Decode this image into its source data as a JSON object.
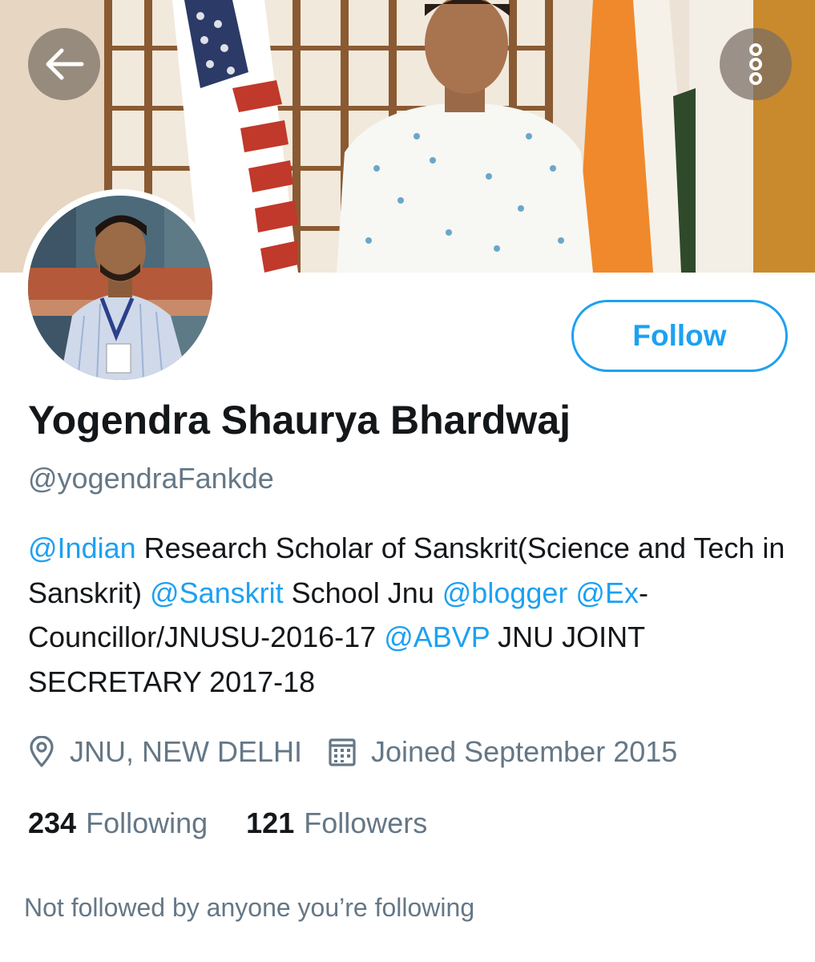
{
  "banner": {
    "back_icon": "arrow-left-icon",
    "more_icon": "more-vertical-icon"
  },
  "profile": {
    "display_name": "Yogendra Shaurya Bhardwaj",
    "handle": "@yogendraFankde",
    "follow_label": "Follow",
    "bio_segments": [
      {
        "text": "@Indian",
        "type": "mention"
      },
      {
        "text": " Research Scholar of Sanskrit(Science and Tech in Sanskrit) ",
        "type": "text"
      },
      {
        "text": "@Sanskrit",
        "type": "mention"
      },
      {
        "text": " School Jnu ",
        "type": "text"
      },
      {
        "text": "@blogger",
        "type": "mention"
      },
      {
        "text": " ",
        "type": "text"
      },
      {
        "text": "@Ex",
        "type": "mention"
      },
      {
        "text": "-Councillor/JNUSU-2016-17 ",
        "type": "text"
      },
      {
        "text": "@ABVP",
        "type": "mention"
      },
      {
        "text": " JNU JOINT SECRETARY 2017-18",
        "type": "text"
      }
    ],
    "location": "JNU, NEW DELHI",
    "location_icon": "location-pin-icon",
    "joined": "Joined September 2015",
    "joined_icon": "calendar-icon",
    "following_count": "234",
    "following_label": "Following",
    "followers_count": "121",
    "followers_label": "Followers",
    "followed_by_note": "Not followed by anyone you’re following"
  },
  "colors": {
    "accent": "#1da1f2",
    "secondary_text": "#657786",
    "primary_text": "#14171a"
  }
}
